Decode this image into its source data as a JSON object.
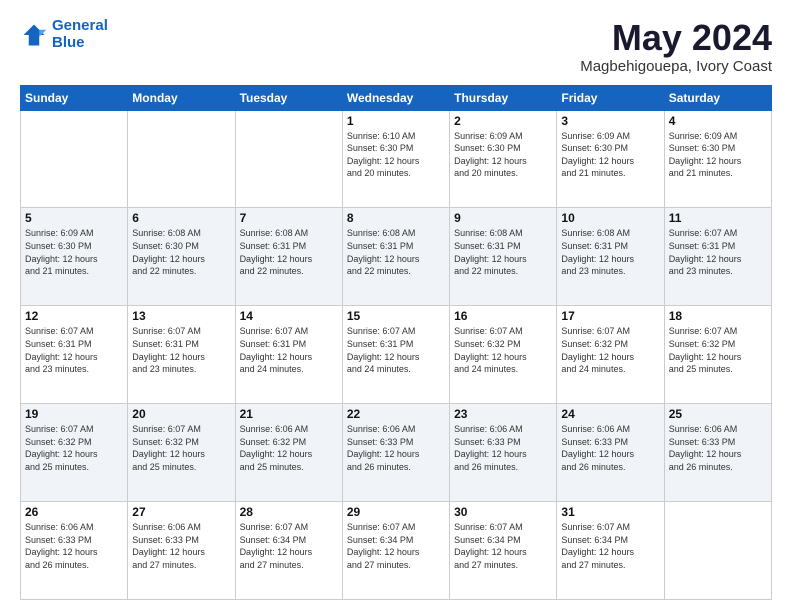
{
  "header": {
    "logo_line1": "General",
    "logo_line2": "Blue",
    "title": "May 2024",
    "subtitle": "Magbehigouepa, Ivory Coast"
  },
  "weekdays": [
    "Sunday",
    "Monday",
    "Tuesday",
    "Wednesday",
    "Thursday",
    "Friday",
    "Saturday"
  ],
  "weeks": [
    [
      {
        "day": "",
        "info": ""
      },
      {
        "day": "",
        "info": ""
      },
      {
        "day": "",
        "info": ""
      },
      {
        "day": "1",
        "info": "Sunrise: 6:10 AM\nSunset: 6:30 PM\nDaylight: 12 hours\nand 20 minutes."
      },
      {
        "day": "2",
        "info": "Sunrise: 6:09 AM\nSunset: 6:30 PM\nDaylight: 12 hours\nand 20 minutes."
      },
      {
        "day": "3",
        "info": "Sunrise: 6:09 AM\nSunset: 6:30 PM\nDaylight: 12 hours\nand 21 minutes."
      },
      {
        "day": "4",
        "info": "Sunrise: 6:09 AM\nSunset: 6:30 PM\nDaylight: 12 hours\nand 21 minutes."
      }
    ],
    [
      {
        "day": "5",
        "info": "Sunrise: 6:09 AM\nSunset: 6:30 PM\nDaylight: 12 hours\nand 21 minutes."
      },
      {
        "day": "6",
        "info": "Sunrise: 6:08 AM\nSunset: 6:30 PM\nDaylight: 12 hours\nand 22 minutes."
      },
      {
        "day": "7",
        "info": "Sunrise: 6:08 AM\nSunset: 6:31 PM\nDaylight: 12 hours\nand 22 minutes."
      },
      {
        "day": "8",
        "info": "Sunrise: 6:08 AM\nSunset: 6:31 PM\nDaylight: 12 hours\nand 22 minutes."
      },
      {
        "day": "9",
        "info": "Sunrise: 6:08 AM\nSunset: 6:31 PM\nDaylight: 12 hours\nand 22 minutes."
      },
      {
        "day": "10",
        "info": "Sunrise: 6:08 AM\nSunset: 6:31 PM\nDaylight: 12 hours\nand 23 minutes."
      },
      {
        "day": "11",
        "info": "Sunrise: 6:07 AM\nSunset: 6:31 PM\nDaylight: 12 hours\nand 23 minutes."
      }
    ],
    [
      {
        "day": "12",
        "info": "Sunrise: 6:07 AM\nSunset: 6:31 PM\nDaylight: 12 hours\nand 23 minutes."
      },
      {
        "day": "13",
        "info": "Sunrise: 6:07 AM\nSunset: 6:31 PM\nDaylight: 12 hours\nand 23 minutes."
      },
      {
        "day": "14",
        "info": "Sunrise: 6:07 AM\nSunset: 6:31 PM\nDaylight: 12 hours\nand 24 minutes."
      },
      {
        "day": "15",
        "info": "Sunrise: 6:07 AM\nSunset: 6:31 PM\nDaylight: 12 hours\nand 24 minutes."
      },
      {
        "day": "16",
        "info": "Sunrise: 6:07 AM\nSunset: 6:32 PM\nDaylight: 12 hours\nand 24 minutes."
      },
      {
        "day": "17",
        "info": "Sunrise: 6:07 AM\nSunset: 6:32 PM\nDaylight: 12 hours\nand 24 minutes."
      },
      {
        "day": "18",
        "info": "Sunrise: 6:07 AM\nSunset: 6:32 PM\nDaylight: 12 hours\nand 25 minutes."
      }
    ],
    [
      {
        "day": "19",
        "info": "Sunrise: 6:07 AM\nSunset: 6:32 PM\nDaylight: 12 hours\nand 25 minutes."
      },
      {
        "day": "20",
        "info": "Sunrise: 6:07 AM\nSunset: 6:32 PM\nDaylight: 12 hours\nand 25 minutes."
      },
      {
        "day": "21",
        "info": "Sunrise: 6:06 AM\nSunset: 6:32 PM\nDaylight: 12 hours\nand 25 minutes."
      },
      {
        "day": "22",
        "info": "Sunrise: 6:06 AM\nSunset: 6:33 PM\nDaylight: 12 hours\nand 26 minutes."
      },
      {
        "day": "23",
        "info": "Sunrise: 6:06 AM\nSunset: 6:33 PM\nDaylight: 12 hours\nand 26 minutes."
      },
      {
        "day": "24",
        "info": "Sunrise: 6:06 AM\nSunset: 6:33 PM\nDaylight: 12 hours\nand 26 minutes."
      },
      {
        "day": "25",
        "info": "Sunrise: 6:06 AM\nSunset: 6:33 PM\nDaylight: 12 hours\nand 26 minutes."
      }
    ],
    [
      {
        "day": "26",
        "info": "Sunrise: 6:06 AM\nSunset: 6:33 PM\nDaylight: 12 hours\nand 26 minutes."
      },
      {
        "day": "27",
        "info": "Sunrise: 6:06 AM\nSunset: 6:33 PM\nDaylight: 12 hours\nand 27 minutes."
      },
      {
        "day": "28",
        "info": "Sunrise: 6:07 AM\nSunset: 6:34 PM\nDaylight: 12 hours\nand 27 minutes."
      },
      {
        "day": "29",
        "info": "Sunrise: 6:07 AM\nSunset: 6:34 PM\nDaylight: 12 hours\nand 27 minutes."
      },
      {
        "day": "30",
        "info": "Sunrise: 6:07 AM\nSunset: 6:34 PM\nDaylight: 12 hours\nand 27 minutes."
      },
      {
        "day": "31",
        "info": "Sunrise: 6:07 AM\nSunset: 6:34 PM\nDaylight: 12 hours\nand 27 minutes."
      },
      {
        "day": "",
        "info": ""
      }
    ]
  ]
}
